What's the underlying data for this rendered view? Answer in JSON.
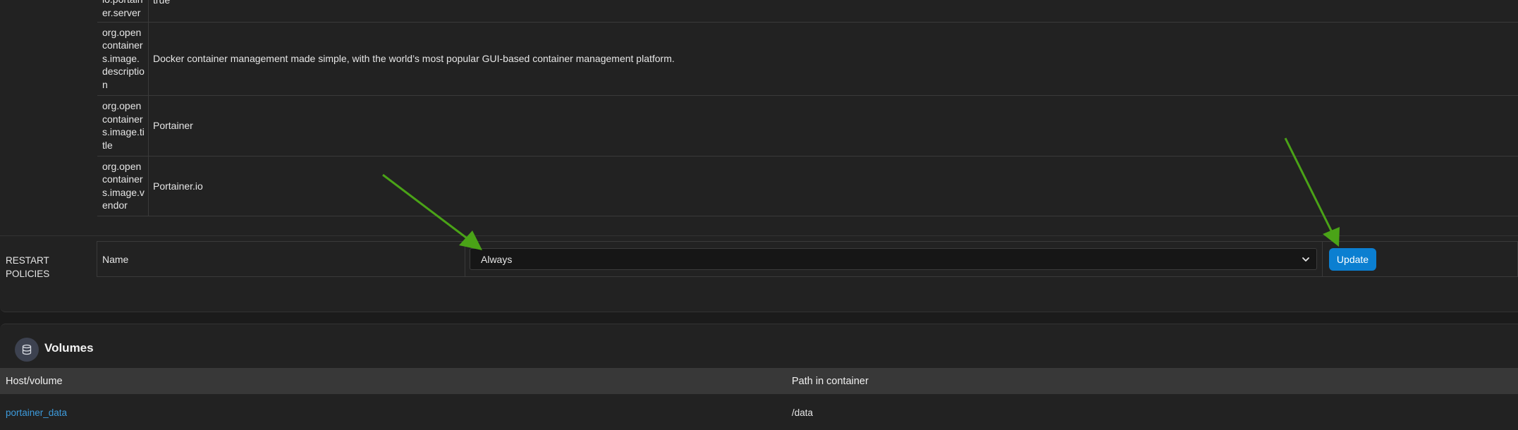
{
  "labels": [
    {
      "key": "io.portainer.server",
      "value": "true"
    },
    {
      "key": "org.opencontainers.image.description",
      "value": "Docker container management made simple, with the world’s most popular GUI-based container management platform."
    },
    {
      "key": "org.opencontainers.image.title",
      "value": "Portainer"
    },
    {
      "key": "org.opencontainers.image.vendor",
      "value": "Portainer.io"
    }
  ],
  "restart_policies": {
    "section_label": "RESTART POLICIES",
    "name_label": "Name",
    "selected": "Always",
    "update_button": "Update"
  },
  "volumes": {
    "title": "Volumes",
    "columns": [
      "Host/volume",
      "Path in container"
    ],
    "rows": [
      {
        "host": "portainer_data",
        "path": "/data"
      }
    ]
  },
  "colors": {
    "accent": "#0b7fd1",
    "link": "#3d9bdc",
    "annotation_arrow": "#4aa317"
  },
  "icons": {
    "volumes": "database-icon",
    "select": "chevron-down-icon"
  }
}
